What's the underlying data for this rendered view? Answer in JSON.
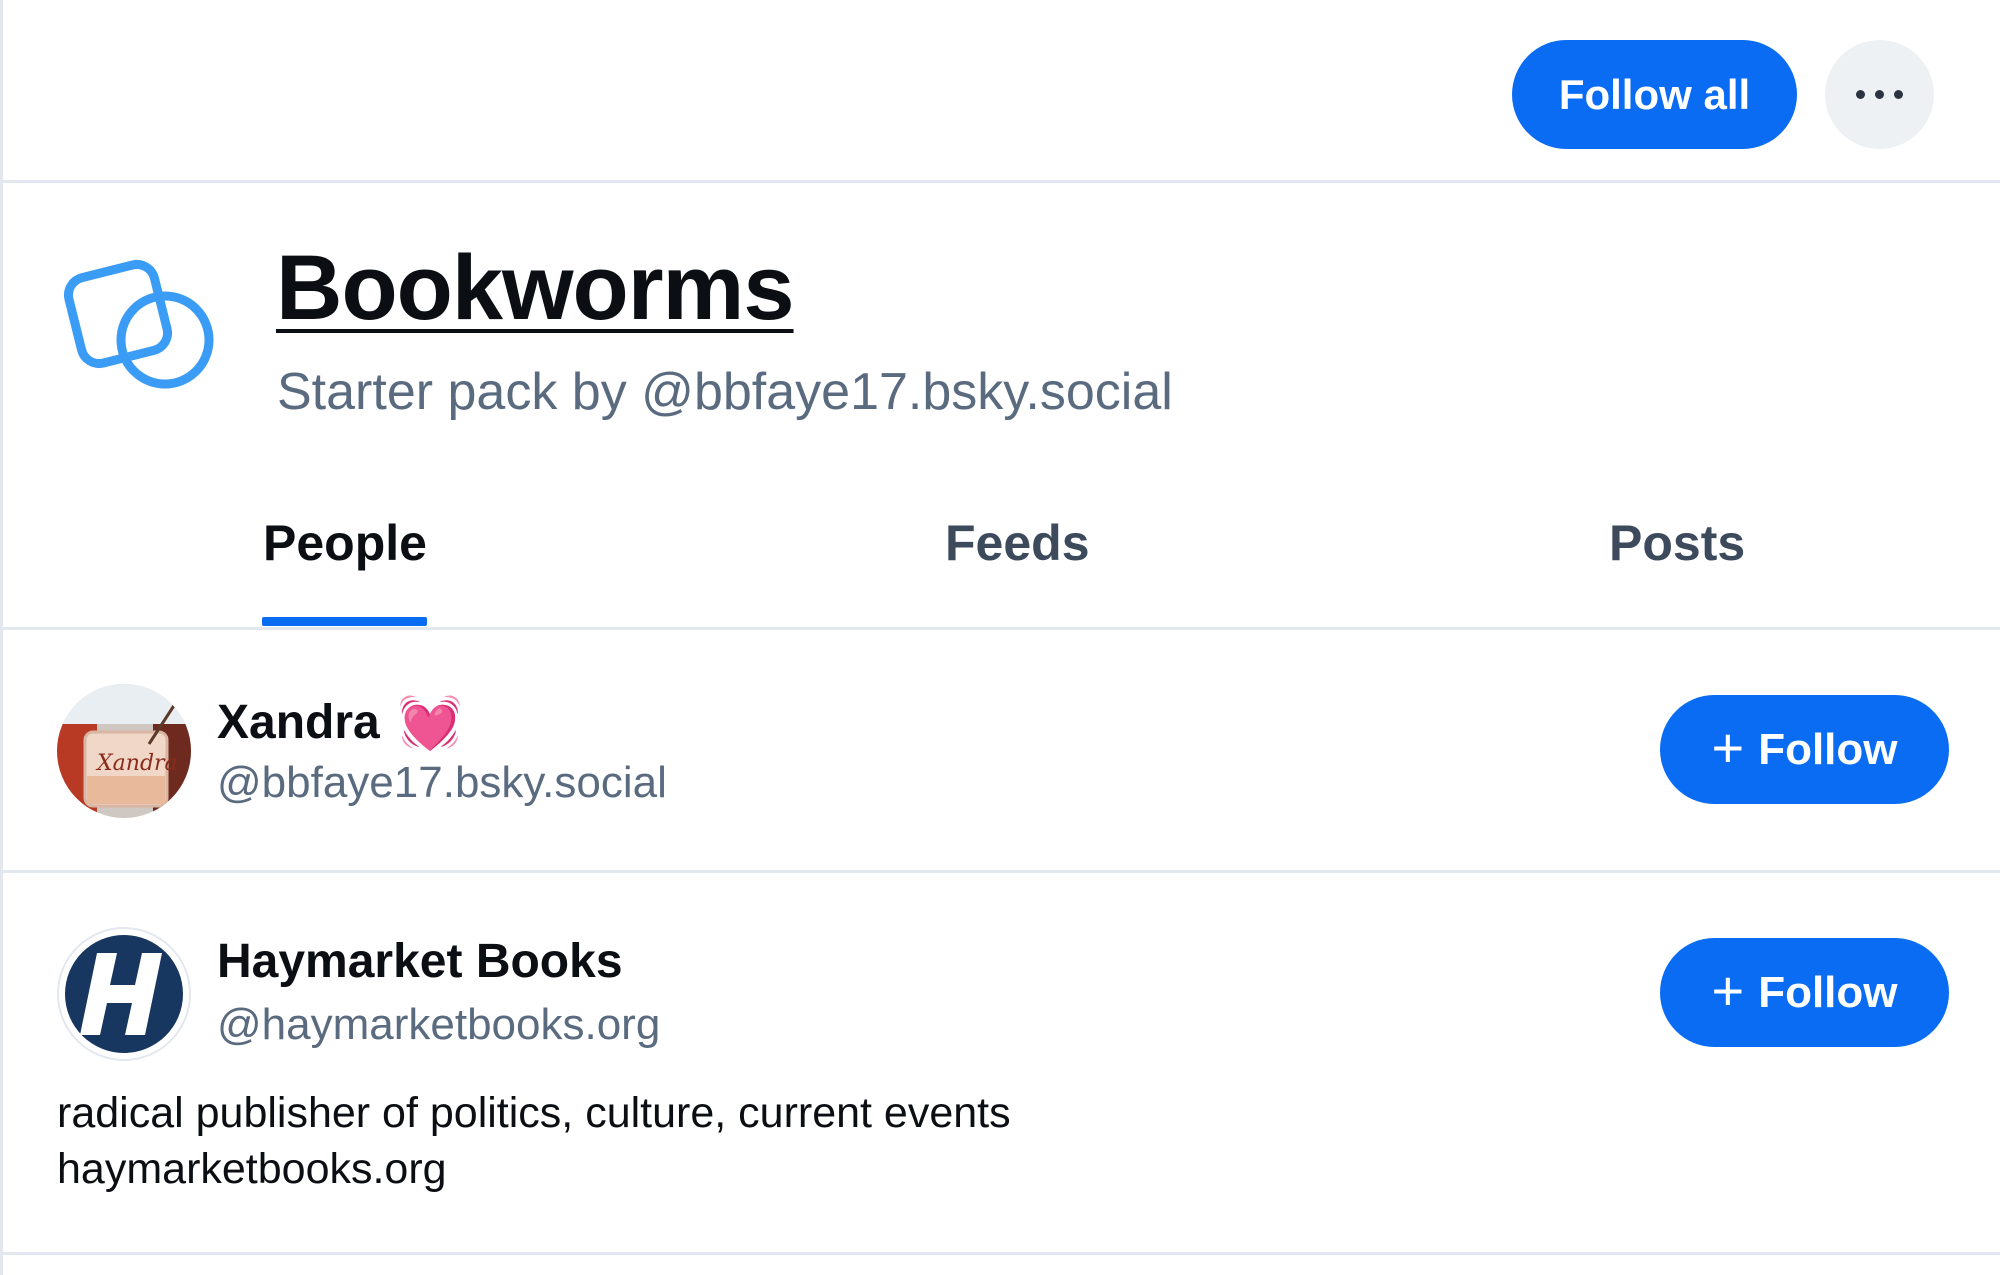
{
  "header": {
    "follow_all_label": "Follow all",
    "more_icon": "ellipsis-icon"
  },
  "pack": {
    "icon": "starter-pack-icon",
    "title": "Bookworms",
    "subtitle": "Starter pack by @bbfaye17.bsky.social"
  },
  "tabs": [
    {
      "label": "People",
      "active": true
    },
    {
      "label": "Feeds",
      "active": false
    },
    {
      "label": "Posts",
      "active": false
    }
  ],
  "people": [
    {
      "name": "Xandra",
      "name_emoji": "💓",
      "handle": "@bbfaye17.bsky.social",
      "follow_label": "Follow",
      "avatar": "candle-photo-avatar"
    },
    {
      "name": "Haymarket Books",
      "handle": "@haymarketbooks.org",
      "follow_label": "Follow",
      "avatar": "haymarket-logo-avatar",
      "bio_line1": "radical publisher of politics, culture, current events",
      "bio_line2": "haymarketbooks.org"
    }
  ],
  "colors": {
    "accent": "#0a6cf3",
    "muted_text": "#5a6b80",
    "divider": "#e3e8ee",
    "pack_icon": "#3b9cf5"
  }
}
